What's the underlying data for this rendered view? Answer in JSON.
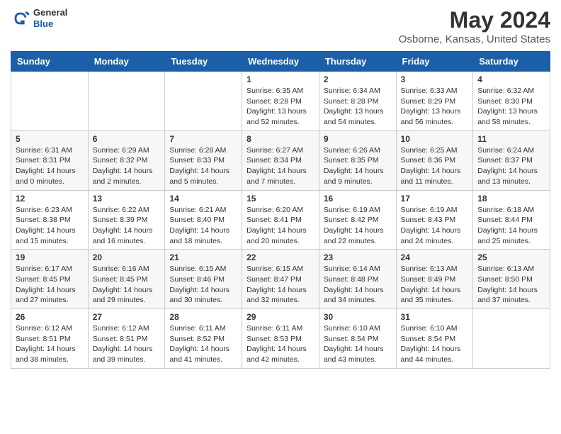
{
  "header": {
    "logo": {
      "general": "General",
      "blue": "Blue"
    },
    "title": "May 2024",
    "location": "Osborne, Kansas, United States"
  },
  "calendar": {
    "weekdays": [
      "Sunday",
      "Monday",
      "Tuesday",
      "Wednesday",
      "Thursday",
      "Friday",
      "Saturday"
    ],
    "weeks": [
      [
        {
          "day": "",
          "info": ""
        },
        {
          "day": "",
          "info": ""
        },
        {
          "day": "",
          "info": ""
        },
        {
          "day": "1",
          "info": "Sunrise: 6:35 AM\nSunset: 8:28 PM\nDaylight: 13 hours\nand 52 minutes."
        },
        {
          "day": "2",
          "info": "Sunrise: 6:34 AM\nSunset: 8:28 PM\nDaylight: 13 hours\nand 54 minutes."
        },
        {
          "day": "3",
          "info": "Sunrise: 6:33 AM\nSunset: 8:29 PM\nDaylight: 13 hours\nand 56 minutes."
        },
        {
          "day": "4",
          "info": "Sunrise: 6:32 AM\nSunset: 8:30 PM\nDaylight: 13 hours\nand 58 minutes."
        }
      ],
      [
        {
          "day": "5",
          "info": "Sunrise: 6:31 AM\nSunset: 8:31 PM\nDaylight: 14 hours\nand 0 minutes."
        },
        {
          "day": "6",
          "info": "Sunrise: 6:29 AM\nSunset: 8:32 PM\nDaylight: 14 hours\nand 2 minutes."
        },
        {
          "day": "7",
          "info": "Sunrise: 6:28 AM\nSunset: 8:33 PM\nDaylight: 14 hours\nand 5 minutes."
        },
        {
          "day": "8",
          "info": "Sunrise: 6:27 AM\nSunset: 8:34 PM\nDaylight: 14 hours\nand 7 minutes."
        },
        {
          "day": "9",
          "info": "Sunrise: 6:26 AM\nSunset: 8:35 PM\nDaylight: 14 hours\nand 9 minutes."
        },
        {
          "day": "10",
          "info": "Sunrise: 6:25 AM\nSunset: 8:36 PM\nDaylight: 14 hours\nand 11 minutes."
        },
        {
          "day": "11",
          "info": "Sunrise: 6:24 AM\nSunset: 8:37 PM\nDaylight: 14 hours\nand 13 minutes."
        }
      ],
      [
        {
          "day": "12",
          "info": "Sunrise: 6:23 AM\nSunset: 8:38 PM\nDaylight: 14 hours\nand 15 minutes."
        },
        {
          "day": "13",
          "info": "Sunrise: 6:22 AM\nSunset: 8:39 PM\nDaylight: 14 hours\nand 16 minutes."
        },
        {
          "day": "14",
          "info": "Sunrise: 6:21 AM\nSunset: 8:40 PM\nDaylight: 14 hours\nand 18 minutes."
        },
        {
          "day": "15",
          "info": "Sunrise: 6:20 AM\nSunset: 8:41 PM\nDaylight: 14 hours\nand 20 minutes."
        },
        {
          "day": "16",
          "info": "Sunrise: 6:19 AM\nSunset: 8:42 PM\nDaylight: 14 hours\nand 22 minutes."
        },
        {
          "day": "17",
          "info": "Sunrise: 6:19 AM\nSunset: 8:43 PM\nDaylight: 14 hours\nand 24 minutes."
        },
        {
          "day": "18",
          "info": "Sunrise: 6:18 AM\nSunset: 8:44 PM\nDaylight: 14 hours\nand 25 minutes."
        }
      ],
      [
        {
          "day": "19",
          "info": "Sunrise: 6:17 AM\nSunset: 8:45 PM\nDaylight: 14 hours\nand 27 minutes."
        },
        {
          "day": "20",
          "info": "Sunrise: 6:16 AM\nSunset: 8:45 PM\nDaylight: 14 hours\nand 29 minutes."
        },
        {
          "day": "21",
          "info": "Sunrise: 6:15 AM\nSunset: 8:46 PM\nDaylight: 14 hours\nand 30 minutes."
        },
        {
          "day": "22",
          "info": "Sunrise: 6:15 AM\nSunset: 8:47 PM\nDaylight: 14 hours\nand 32 minutes."
        },
        {
          "day": "23",
          "info": "Sunrise: 6:14 AM\nSunset: 8:48 PM\nDaylight: 14 hours\nand 34 minutes."
        },
        {
          "day": "24",
          "info": "Sunrise: 6:13 AM\nSunset: 8:49 PM\nDaylight: 14 hours\nand 35 minutes."
        },
        {
          "day": "25",
          "info": "Sunrise: 6:13 AM\nSunset: 8:50 PM\nDaylight: 14 hours\nand 37 minutes."
        }
      ],
      [
        {
          "day": "26",
          "info": "Sunrise: 6:12 AM\nSunset: 8:51 PM\nDaylight: 14 hours\nand 38 minutes."
        },
        {
          "day": "27",
          "info": "Sunrise: 6:12 AM\nSunset: 8:51 PM\nDaylight: 14 hours\nand 39 minutes."
        },
        {
          "day": "28",
          "info": "Sunrise: 6:11 AM\nSunset: 8:52 PM\nDaylight: 14 hours\nand 41 minutes."
        },
        {
          "day": "29",
          "info": "Sunrise: 6:11 AM\nSunset: 8:53 PM\nDaylight: 14 hours\nand 42 minutes."
        },
        {
          "day": "30",
          "info": "Sunrise: 6:10 AM\nSunset: 8:54 PM\nDaylight: 14 hours\nand 43 minutes."
        },
        {
          "day": "31",
          "info": "Sunrise: 6:10 AM\nSunset: 8:54 PM\nDaylight: 14 hours\nand 44 minutes."
        },
        {
          "day": "",
          "info": ""
        }
      ]
    ]
  }
}
